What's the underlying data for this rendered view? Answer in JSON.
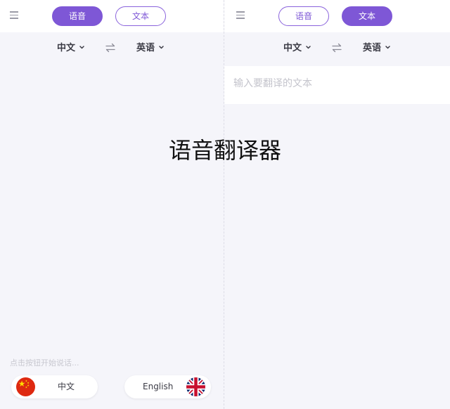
{
  "overlay": {
    "title": "语音翻译器"
  },
  "left_screen": {
    "tabs": {
      "voice_label": "语音",
      "text_label": "文本",
      "active": "voice"
    },
    "source_language": "中文",
    "target_language": "英语",
    "hint": "点击按钮开始说话...",
    "buttons": {
      "source_label": "中文",
      "target_label": "English"
    }
  },
  "right_screen": {
    "tabs": {
      "voice_label": "语音",
      "text_label": "文本",
      "active": "text"
    },
    "source_language": "中文",
    "target_language": "英语",
    "input_placeholder": "输入要翻译的文本",
    "input_value": ""
  },
  "colors": {
    "accent": "#7e57d6",
    "background": "#f5f5fa",
    "surface": "#ffffff"
  },
  "icons": [
    "menu-icon",
    "chevron-down-icon",
    "swap-icon",
    "china-flag-icon",
    "uk-flag-icon"
  ]
}
